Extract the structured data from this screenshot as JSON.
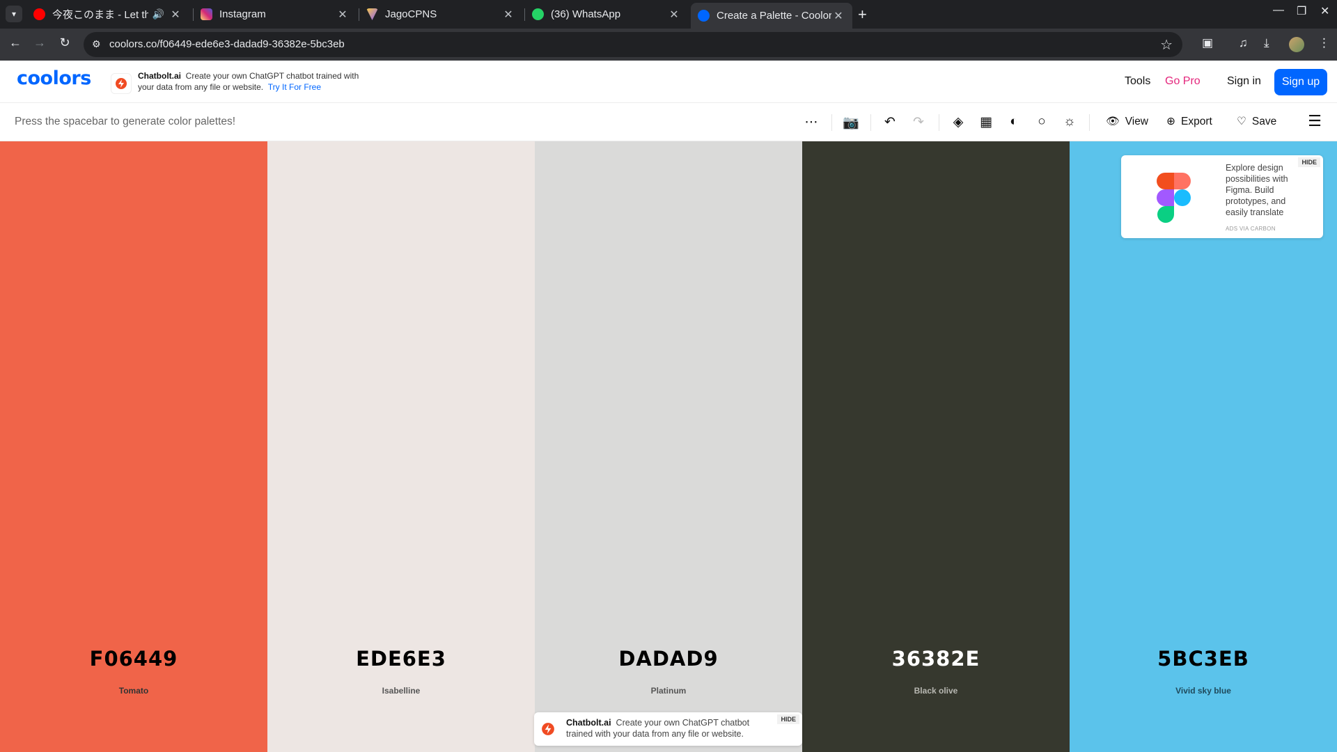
{
  "browser": {
    "tabs": [
      {
        "title": "今夜このまま - Let the N",
        "favicon_color": "#ff0000",
        "audio_icon": "speaker-icon"
      },
      {
        "title": "Instagram",
        "favicon_color": "#d6249f"
      },
      {
        "title": "JagoCPNS",
        "favicon_color": "#8a5cf6"
      },
      {
        "title": "(36) WhatsApp",
        "favicon_color": "#25d366"
      },
      {
        "title": "Create a Palette - Coolors",
        "favicon_color": "#0066ff"
      }
    ],
    "url": "coolors.co/f06449-ede6e3-dadad9-36382e-5bc3eb"
  },
  "header": {
    "logo": "coolors",
    "ad": {
      "brand": "Chatbolt.ai",
      "text": "Create your own ChatGPT chatbot trained with your data from any file or website.",
      "cta": "Try It For Free"
    },
    "tools": "Tools",
    "gopro": "Go Pro",
    "signin": "Sign in",
    "signup": "Sign up"
  },
  "toolbar": {
    "hint": "Press the spacebar to generate color palettes!",
    "view": "View",
    "export": "Export",
    "save": "Save"
  },
  "palette": [
    {
      "hex": "F06449",
      "name": "Tomato",
      "bg": "#f06449",
      "fg": "#000000",
      "fg_name": "#333333"
    },
    {
      "hex": "EDE6E3",
      "name": "Isabelline",
      "bg": "#ede6e3",
      "fg": "#000000",
      "fg_name": "#555555"
    },
    {
      "hex": "DADAD9",
      "name": "Platinum",
      "bg": "#dadad9",
      "fg": "#000000",
      "fg_name": "#555555"
    },
    {
      "hex": "36382E",
      "name": "Black olive",
      "bg": "#36382e",
      "fg": "#ffffff",
      "fg_name": "#b8b8b2"
    },
    {
      "hex": "5BC3EB",
      "name": "Vivid sky blue",
      "bg": "#5bc3eb",
      "fg": "#000000",
      "fg_name": "#1f4a5c"
    }
  ],
  "carbon_ad": {
    "text": "Explore design possibilities with Figma. Build prototypes, and easily translate",
    "via": "ADS VIA CARBON",
    "hide": "HIDE"
  },
  "bottom_ad": {
    "brand": "Chatbolt.ai",
    "text": "Create your own ChatGPT chatbot trained with your data from any file or website.",
    "hide": "HIDE"
  }
}
